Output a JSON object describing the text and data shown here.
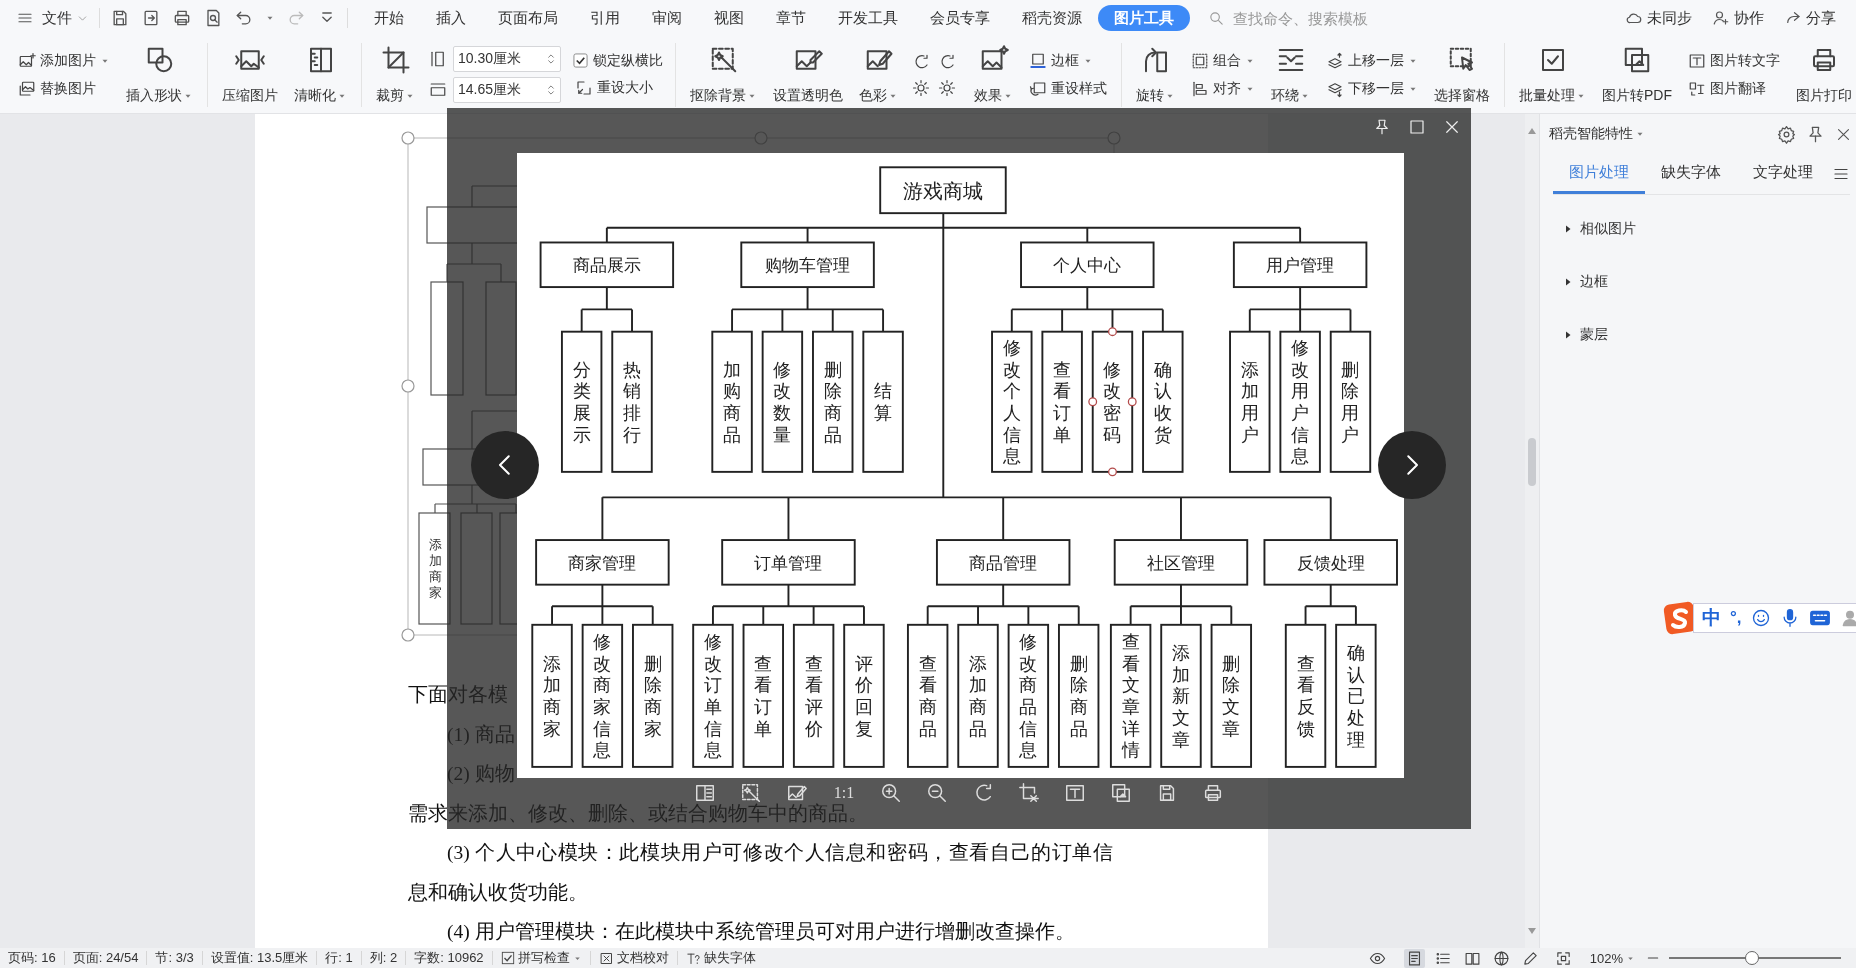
{
  "menu_bar": {
    "file_menu": "文件",
    "tabs": [
      {
        "label": "开始",
        "selected": false
      },
      {
        "label": "插入",
        "selected": false
      },
      {
        "label": "页面布局",
        "selected": false
      },
      {
        "label": "引用",
        "selected": false
      },
      {
        "label": "审阅",
        "selected": false
      },
      {
        "label": "视图",
        "selected": false
      },
      {
        "label": "章节",
        "selected": false
      },
      {
        "label": "开发工具",
        "selected": false
      },
      {
        "label": "会员专享",
        "selected": false
      },
      {
        "label": "稻壳资源",
        "selected": false
      },
      {
        "label": "图片工具",
        "selected": true
      }
    ],
    "search": {
      "placeholder": "查找命令、搜索模板"
    },
    "actions": [
      "未同步",
      "协作",
      "分享"
    ]
  },
  "ribbon": {
    "groups": [
      [
        {
          "kind": "stack",
          "items": [
            {
              "kind": "button",
              "label": "添加图片",
              "dropdown": true
            },
            {
              "kind": "button",
              "label": "替换图片",
              "dropdown": false
            }
          ]
        },
        {
          "kind": "large",
          "label": "插入形状",
          "dropdown": true
        }
      ],
      [
        {
          "kind": "large",
          "label": "压缩图片",
          "dropdown": false
        },
        {
          "kind": "large",
          "label": "清晰化",
          "dropdown": true
        }
      ],
      [
        {
          "kind": "large",
          "label": "裁剪",
          "dropdown": true
        },
        {
          "kind": "size",
          "fields": [
            "10.30厘米",
            "14.65厘米"
          ]
        },
        {
          "kind": "stack",
          "items": [
            {
              "kind": "checkbox",
              "label": "锁定纵横比",
              "checked": true
            },
            {
              "kind": "button",
              "label": "重设大小",
              "dropdown": false
            }
          ]
        }
      ],
      [
        {
          "kind": "large",
          "label": "抠除背景",
          "dropdown": true
        },
        {
          "kind": "large",
          "label": "设置透明色",
          "dropdown": false
        },
        {
          "kind": "large",
          "label": "色彩",
          "dropdown": true
        },
        {
          "kind": "icon_grid"
        },
        {
          "kind": "large",
          "label": "效果",
          "dropdown": true
        },
        {
          "kind": "stack",
          "items": [
            {
              "kind": "button",
              "label": "边框",
              "dropdown": true
            },
            {
              "kind": "button",
              "label": "重设样式",
              "dropdown": false
            }
          ]
        }
      ],
      [
        {
          "kind": "large",
          "label": "旋转",
          "dropdown": true
        },
        {
          "kind": "stack",
          "items": [
            {
              "kind": "button",
              "label": "组合",
              "dropdown": true
            },
            {
              "kind": "button",
              "label": "对齐",
              "dropdown": true
            }
          ]
        },
        {
          "kind": "large",
          "label": "环绕",
          "dropdown": true
        },
        {
          "kind": "stack",
          "items": [
            {
              "kind": "button",
              "label": "上移一层",
              "dropdown": true
            },
            {
              "kind": "button",
              "label": "下移一层",
              "dropdown": true
            }
          ]
        },
        {
          "kind": "large",
          "label": "选择窗格",
          "dropdown": false
        }
      ],
      [
        {
          "kind": "large",
          "label": "批量处理",
          "dropdown": true
        },
        {
          "kind": "large",
          "label": "图片转PDF",
          "dropdown": false
        },
        {
          "kind": "stack",
          "items": [
            {
              "kind": "button",
              "label": "图片转文字",
              "dropdown": false
            },
            {
              "kind": "button",
              "label": "图片翻译",
              "dropdown": false
            }
          ]
        },
        {
          "kind": "large",
          "label": "图片打印",
          "dropdown": false
        }
      ]
    ]
  },
  "document": {
    "image_labels": [
      "添加商家"
    ],
    "paragraphs": [
      {
        "text": "下面对各模",
        "indent": false
      },
      {
        "text": "(1) 商品",
        "indent": true
      },
      {
        "text": "(2) 购物",
        "indent": true
      },
      {
        "text": "需求来添加、修改、删除、或结合购物车中的商品。",
        "indent": false
      },
      {
        "text": "(3) 个人中心模块：此模块用户可修改个人信息和密码，查看自己的订单信息和确认收货功能。",
        "indent": true
      },
      {
        "text": "(4) 用户管理模块：在此模块中系统管理员可对用户进行增删改查操作。",
        "indent": true
      }
    ]
  },
  "viewer": {
    "toolbar": {
      "actual_size_label": "1:1"
    },
    "diagram": {
      "root": "游戏商城",
      "upper_modules": [
        {
          "label": "商品展示",
          "children": [
            {
              "label": "分类展示",
              "selected": false
            },
            {
              "label": "热销排行",
              "selected": false
            }
          ]
        },
        {
          "label": "购物车管理",
          "children": [
            {
              "label": "加购商品",
              "selected": false
            },
            {
              "label": "修改数量",
              "selected": false
            },
            {
              "label": "删除商品",
              "selected": false
            },
            {
              "label": "结算",
              "selected": false
            }
          ]
        },
        {
          "label": "个人中心",
          "children": [
            {
              "label": "修改个人信息",
              "selected": false
            },
            {
              "label": "查看订单",
              "selected": false
            },
            {
              "label": "修改密码",
              "selected": true
            },
            {
              "label": "确认收货",
              "selected": false
            }
          ]
        },
        {
          "label": "用户管理",
          "children": [
            {
              "label": "添加用户",
              "selected": false
            },
            {
              "label": "修改用户信息",
              "selected": false
            },
            {
              "label": "删除用户",
              "selected": false
            }
          ]
        }
      ],
      "lower_modules": [
        {
          "label": "商家管理",
          "children": [
            {
              "label": "添加商家",
              "selected": false
            },
            {
              "label": "修改商家信息",
              "selected": false
            },
            {
              "label": "删除商家",
              "selected": false
            }
          ]
        },
        {
          "label": "订单管理",
          "children": [
            {
              "label": "修改订单信息",
              "selected": false
            },
            {
              "label": "查看订单",
              "selected": false
            },
            {
              "label": "查看评价",
              "selected": false
            },
            {
              "label": "评价回复",
              "selected": false
            }
          ]
        },
        {
          "label": "商品管理",
          "children": [
            {
              "label": "查看商品",
              "selected": false
            },
            {
              "label": "添加商品",
              "selected": false
            },
            {
              "label": "修改商品信息",
              "selected": false
            },
            {
              "label": "删除商品",
              "selected": false
            }
          ]
        },
        {
          "label": "社区管理",
          "children": [
            {
              "label": "查看文章详情",
              "selected": false
            },
            {
              "label": "添加新文章",
              "selected": false
            },
            {
              "label": "删除文章",
              "selected": false
            }
          ]
        },
        {
          "label": "反馈处理",
          "children": [
            {
              "label": "查看反馈",
              "selected": false
            },
            {
              "label": "确认已处理",
              "selected": false
            }
          ]
        }
      ]
    }
  },
  "side_panel": {
    "title": "稻壳智能特性",
    "tabs": [
      {
        "label": "图片处理",
        "selected": true
      },
      {
        "label": "缺失字体",
        "selected": false
      },
      {
        "label": "文字处理",
        "selected": false
      }
    ],
    "sections": [
      {
        "label": "相似图片",
        "expanded": false
      },
      {
        "label": "边框",
        "expanded": false
      },
      {
        "label": "蒙层",
        "expanded": false
      }
    ]
  },
  "ime_toolbar": {
    "mode": "中",
    "punctuation": "°,"
  },
  "status_bar": {
    "fields": [
      "页码: 16",
      "页面: 24/54",
      "节: 3/3",
      "设置值: 13.5厘米",
      "行: 1",
      "列: 2",
      "字数: 10962"
    ],
    "spell_check": {
      "label": "拼写检查",
      "checked": true
    },
    "proofread": "文档校对",
    "missing_fonts": "缺失字体",
    "view_modes": [
      {
        "selected": true
      },
      {
        "selected": false
      },
      {
        "selected": false
      },
      {
        "selected": false
      },
      {
        "selected": false
      }
    ],
    "zoom": {
      "label": "102%",
      "level": 0.48
    }
  }
}
